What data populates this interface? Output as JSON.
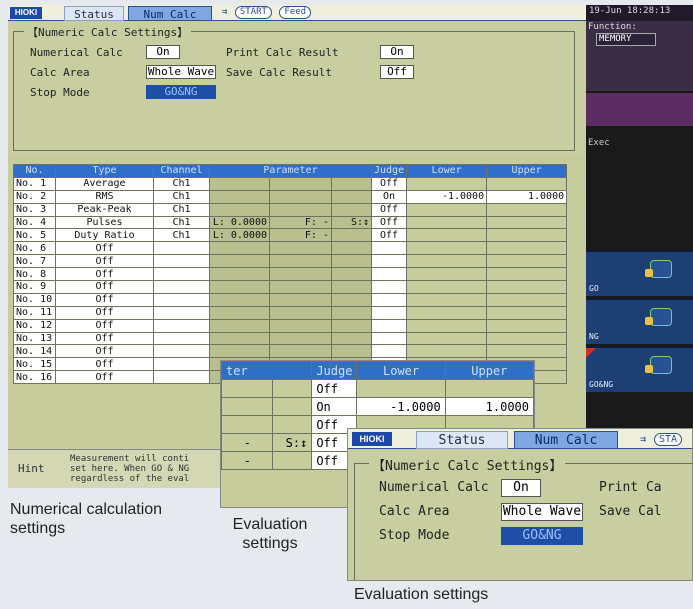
{
  "header": {
    "logo": "HIOKI",
    "tabs": [
      "Status",
      "Num Calc"
    ],
    "start_label": "START",
    "feed_label": "Feed"
  },
  "settings": {
    "group_title": "【Numeric Calc Settings】",
    "numerical_calc_label": "Numerical Calc",
    "numerical_calc_value": "On",
    "calc_area_label": "Calc Area",
    "calc_area_value": "Whole Wave",
    "stop_mode_label": "Stop Mode",
    "stop_mode_value": "GO&NG",
    "print_calc_result_label": "Print Calc Result",
    "print_calc_result_value": "On",
    "save_calc_result_label": "Save Calc Result",
    "save_calc_result_value": "Off"
  },
  "table": {
    "headers": [
      "No.",
      "Type",
      "Channel",
      "Parameter",
      "Judge",
      "Lower",
      "Upper"
    ],
    "rows": [
      {
        "no": "No. 1",
        "type": "Average",
        "ch": "Ch1",
        "p1": "",
        "p2": "",
        "p3": "",
        "judge": "Off",
        "lower": "",
        "upper": ""
      },
      {
        "no": "No. 2",
        "type": "RMS",
        "ch": "Ch1",
        "p1": "",
        "p2": "",
        "p3": "",
        "judge": "On",
        "lower": "-1.0000",
        "upper": "1.0000"
      },
      {
        "no": "No. 3",
        "type": "Peak-Peak",
        "ch": "Ch1",
        "p1": "",
        "p2": "",
        "p3": "",
        "judge": "Off",
        "lower": "",
        "upper": ""
      },
      {
        "no": "No. 4",
        "type": "Pulses",
        "ch": "Ch1",
        "p1": "L:  0.0000",
        "p2": "F:  -",
        "p3": "S:↕",
        "judge": "Off",
        "lower": "",
        "upper": ""
      },
      {
        "no": "No. 5",
        "type": "Duty Ratio",
        "ch": "Ch1",
        "p1": "L:  0.0000",
        "p2": "F:  -",
        "p3": "",
        "judge": "Off",
        "lower": "",
        "upper": ""
      },
      {
        "no": "No. 6",
        "type": "Off",
        "ch": "",
        "p1": "",
        "p2": "",
        "p3": "",
        "judge": "",
        "lower": "",
        "upper": ""
      },
      {
        "no": "No. 7",
        "type": "Off",
        "ch": "",
        "p1": "",
        "p2": "",
        "p3": "",
        "judge": "",
        "lower": "",
        "upper": ""
      },
      {
        "no": "No. 8",
        "type": "Off",
        "ch": "",
        "p1": "",
        "p2": "",
        "p3": "",
        "judge": "",
        "lower": "",
        "upper": ""
      },
      {
        "no": "No. 9",
        "type": "Off",
        "ch": "",
        "p1": "",
        "p2": "",
        "p3": "",
        "judge": "",
        "lower": "",
        "upper": ""
      },
      {
        "no": "No. 10",
        "type": "Off",
        "ch": "",
        "p1": "",
        "p2": "",
        "p3": "",
        "judge": "",
        "lower": "",
        "upper": ""
      },
      {
        "no": "No. 11",
        "type": "Off",
        "ch": "",
        "p1": "",
        "p2": "",
        "p3": "",
        "judge": "",
        "lower": "",
        "upper": ""
      },
      {
        "no": "No. 12",
        "type": "Off",
        "ch": "",
        "p1": "",
        "p2": "",
        "p3": "",
        "judge": "",
        "lower": "",
        "upper": ""
      },
      {
        "no": "No. 13",
        "type": "Off",
        "ch": "",
        "p1": "",
        "p2": "",
        "p3": "",
        "judge": "",
        "lower": "",
        "upper": ""
      },
      {
        "no": "No. 14",
        "type": "Off",
        "ch": "",
        "p1": "",
        "p2": "",
        "p3": "",
        "judge": "",
        "lower": "",
        "upper": ""
      },
      {
        "no": "No. 15",
        "type": "Off",
        "ch": "",
        "p1": "",
        "p2": "",
        "p3": "",
        "judge": "",
        "lower": "",
        "upper": ""
      },
      {
        "no": "No. 16",
        "type": "Off",
        "ch": "",
        "p1": "",
        "p2": "",
        "p3": "",
        "judge": "",
        "lower": "",
        "upper": ""
      }
    ]
  },
  "hint": {
    "label": "Hint",
    "text": [
      "Measurement will conti",
      "set here. When GO & NG",
      "regardless of the eval"
    ]
  },
  "side": {
    "datetime": "19-Jun 18:28:13",
    "function_label": "Function:",
    "function_value": "MEMORY",
    "exec_label": "Exec",
    "buttons": [
      "GO",
      "NG",
      "GO&NG"
    ]
  },
  "zoom_eval": {
    "headers": [
      "ter",
      "Judge",
      "Lower",
      "Upper"
    ],
    "rows": [
      {
        "a": "",
        "b": "",
        "judge": "Off",
        "lower": "",
        "upper": ""
      },
      {
        "a": "",
        "b": "",
        "judge": "On",
        "lower": "-1.0000",
        "upper": "1.0000"
      },
      {
        "a": "",
        "b": "",
        "judge": "Off",
        "lower": "",
        "upper": ""
      },
      {
        "a": "-",
        "b": "S:↕",
        "judge": "Off",
        "lower": "",
        "upper": ""
      },
      {
        "a": "-",
        "b": "",
        "judge": "Off",
        "lower": "",
        "upper": ""
      }
    ]
  },
  "zoom_settings": {
    "logo": "HIOKI",
    "tabs": [
      "Status",
      "Num Calc"
    ],
    "start_label": "STA",
    "group_title": "【Numeric Calc Settings】",
    "numerical_calc_label": "Numerical Calc",
    "numerical_calc_value": "On",
    "print_label": "Print Ca",
    "calc_area_label": "Calc Area",
    "calc_area_value": "Whole Wave",
    "save_label": "Save Cal",
    "stop_mode_label": "Stop Mode",
    "stop_mode_value": "GO&NG"
  },
  "captions": {
    "numerical_calculation_settings": "Numerical calculation settings",
    "evaluation_settings_small": "Evaluation settings",
    "evaluation_settings_large": "Evaluation settings"
  }
}
